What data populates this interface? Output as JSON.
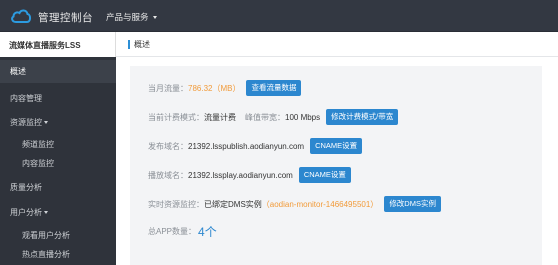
{
  "header": {
    "app_title": "管理控制台",
    "menu_label": "产品与服务"
  },
  "sidebar": {
    "service_title": "流媒体直播服务LSS",
    "items": [
      {
        "label": "概述"
      },
      {
        "label": "内容管理"
      },
      {
        "label": "资源监控"
      },
      {
        "label": "频道监控"
      },
      {
        "label": "内容监控"
      },
      {
        "label": "质量分析"
      },
      {
        "label": "用户分析"
      },
      {
        "label": "观看用户分析"
      },
      {
        "label": "热点直播分析"
      }
    ]
  },
  "breadcrumb": {
    "current": "概述"
  },
  "overview": {
    "traffic_label": "当月流量：",
    "traffic_value": "786.32（MB）",
    "traffic_button": "查看流量数据",
    "billing_label": "当前计费模式：",
    "billing_value": "流量计费",
    "bandwidth_label": "峰值带宽：",
    "bandwidth_value": "100 Mbps",
    "billing_button": "修改计费模式/带宽",
    "publish_label": "发布域名：",
    "publish_value": "21392.lsspublish.aodianyun.com",
    "publish_button": "CNAME设置",
    "play_label": "播放域名：",
    "play_value": "21392.lssplay.aodianyun.com",
    "play_button": "CNAME设置",
    "monitor_label": "实时资源监控：",
    "monitor_value": "已绑定DMS实例",
    "monitor_instance": "（aodian-monitor-1466495501）",
    "monitor_button": "修改DMS实例",
    "app_count_label": "总APP数量：",
    "app_count_value": "4个"
  }
}
